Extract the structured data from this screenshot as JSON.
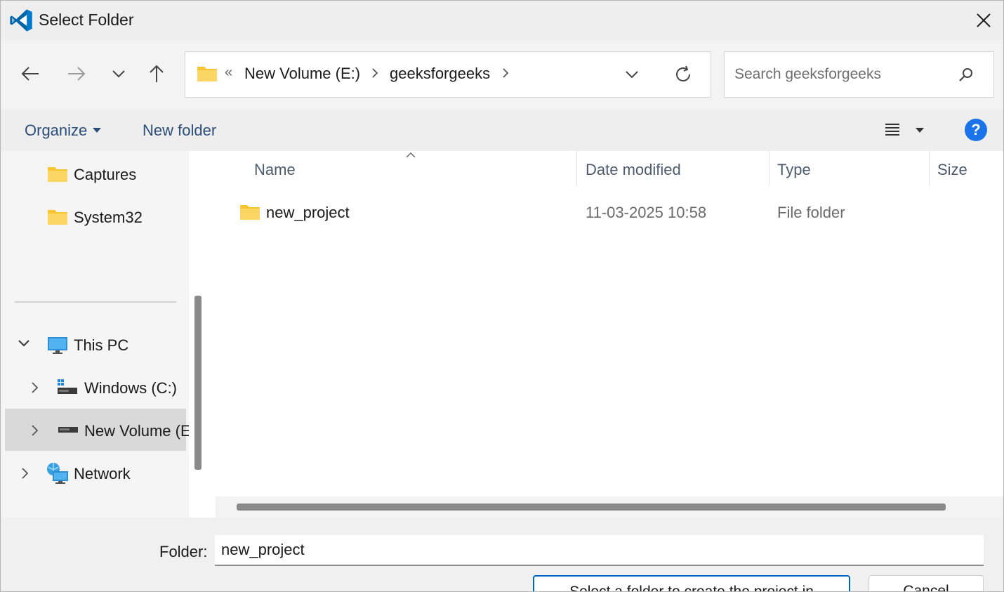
{
  "window": {
    "title": "Select Folder"
  },
  "address": {
    "overflow_marker": "«",
    "segments": [
      "New Volume (E:)",
      "geeksforgeeks"
    ]
  },
  "search": {
    "placeholder": "Search geeksforgeeks"
  },
  "toolbar": {
    "organize_label": "Organize",
    "new_folder_label": "New folder",
    "help_label": "?"
  },
  "sidebar": {
    "quick_access": [
      {
        "label": "Captures",
        "icon": "folder-icon"
      },
      {
        "label": "System32",
        "icon": "folder-icon"
      }
    ],
    "this_pc": {
      "label": "This PC",
      "icon": "monitor-icon",
      "expanded": true
    },
    "drives": [
      {
        "label": "Windows (C:)",
        "icon": "system-drive-icon",
        "selected": false
      },
      {
        "label": "New Volume (E:)",
        "icon": "drive-icon",
        "selected": true
      }
    ],
    "network": {
      "label": "Network",
      "icon": "network-icon"
    }
  },
  "table": {
    "columns": [
      "Name",
      "Date modified",
      "Type",
      "Size"
    ],
    "sort_column": "Name",
    "rows": [
      {
        "name": "new_project",
        "date_modified": "11-03-2025 10:58",
        "type": "File folder",
        "size": ""
      }
    ]
  },
  "footer": {
    "folder_label": "Folder:",
    "folder_value": "new_project",
    "primary_button": "Select a folder to create the project in",
    "cancel_button": "Cancel"
  },
  "colors": {
    "accent": "#0067c0",
    "folder_yellow": "#f8c430",
    "link_blue": "#2b4d7a",
    "help_blue": "#1a73e8"
  }
}
